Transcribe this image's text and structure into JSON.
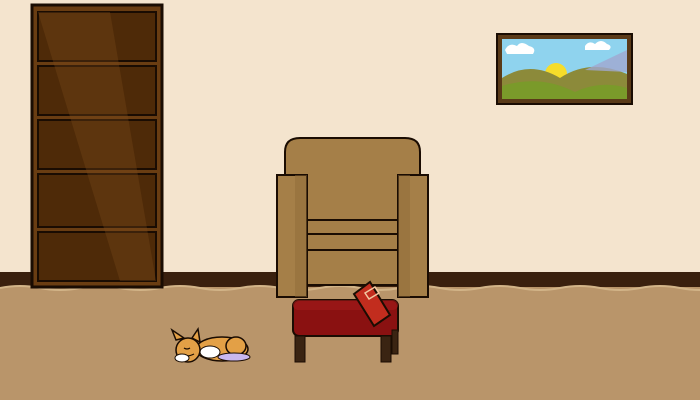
{
  "scene": {
    "name": "living-room",
    "colors": {
      "wall": "#f7e9d4",
      "wall_shadow": "#efdcc2",
      "baseboard": "#3a200e",
      "carpet": "#b9956a",
      "bookshelf": "#6a3d12",
      "bookshelf_dark": "#4e2a08",
      "armchair": "#a57f48",
      "armchair_dark": "#8d6a38",
      "ottoman": "#8a1111",
      "ottoman_legs": "#3a2412",
      "book": "#c22d1e",
      "frame": "#5a3a18",
      "sky": "#8fd3ee",
      "hill_green": "#7a9a2a",
      "hill_olive": "#8c8a3a",
      "sun": "#f6dd2a",
      "dog_fur": "#e3a046",
      "dog_white": "#ffffff",
      "dog_belly": "#c9b8f0"
    },
    "objects": {
      "bookshelf": {
        "icon": "bookshelf-icon",
        "shelves": 5
      },
      "painting": {
        "icon": "landscape-painting-icon"
      },
      "armchair": {
        "icon": "armchair-icon"
      },
      "ottoman": {
        "icon": "ottoman-icon"
      },
      "book": {
        "icon": "red-book-icon"
      },
      "dog": {
        "icon": "sleeping-dog-icon"
      }
    }
  }
}
